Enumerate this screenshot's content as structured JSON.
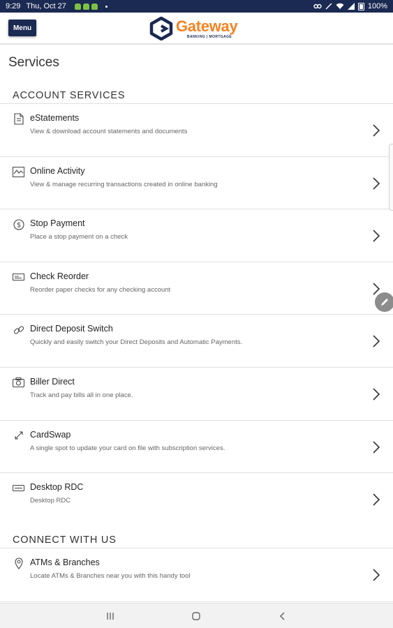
{
  "status_bar": {
    "time": "9:29",
    "date": "Thu, Oct 27",
    "battery": "100%"
  },
  "header": {
    "menu_label": "Menu",
    "brand": "Gateway",
    "tagline": "BANKING | MORTGAGE",
    "colors": {
      "navy": "#1b2a52",
      "orange": "#f58220"
    }
  },
  "page": {
    "title": "Services"
  },
  "sections": [
    {
      "heading": "ACCOUNT SERVICES",
      "items": [
        {
          "icon": "document-icon",
          "title": "eStatements",
          "description": "View & download account statements and documents"
        },
        {
          "icon": "activity-chart-icon",
          "title": "Online Activity",
          "description": "View & manage recurring transactions created in online banking"
        },
        {
          "icon": "dollar-circle-icon",
          "title": "Stop Payment",
          "description": "Place a stop payment on a check"
        },
        {
          "icon": "check-icon",
          "title": "Check Reorder",
          "description": "Reorder paper checks for any checking account"
        },
        {
          "icon": "link-icon",
          "title": "Direct Deposit Switch",
          "description": "Quickly and easily switch your Direct Deposits and Automatic Payments."
        },
        {
          "icon": "camera-icon",
          "title": "Biller Direct",
          "description": "Track and pay bills all in one place."
        },
        {
          "icon": "card-swap-icon",
          "title": "CardSwap",
          "description": "A single spot to update your card on file with subscription services."
        },
        {
          "icon": "scanner-icon",
          "title": "Desktop RDC",
          "description": "Desktop RDC"
        }
      ]
    },
    {
      "heading": "CONNECT WITH US",
      "items": [
        {
          "icon": "location-pin-icon",
          "title": "ATMs & Branches",
          "description": "Locate ATMs & Branches near you with this handy tool"
        }
      ]
    }
  ]
}
